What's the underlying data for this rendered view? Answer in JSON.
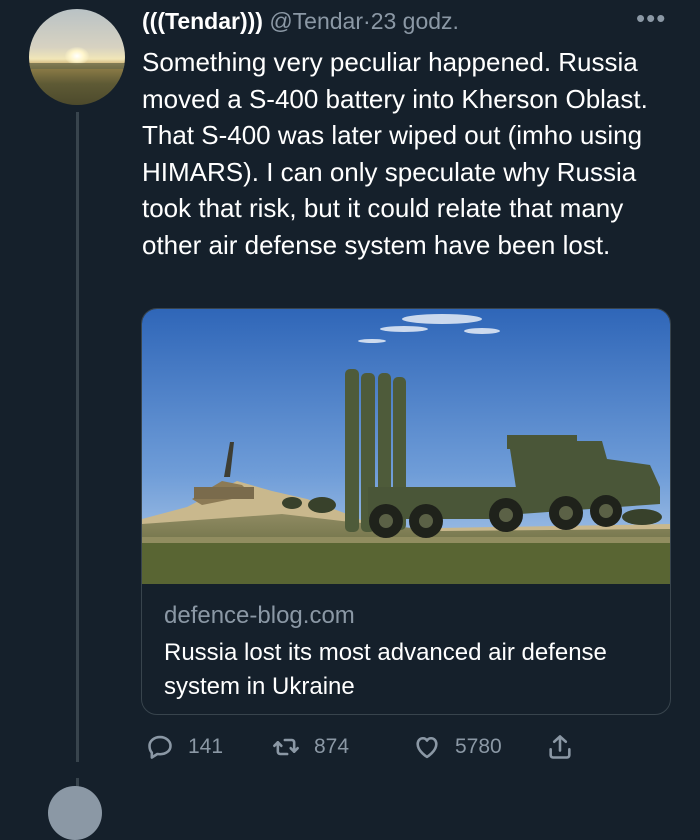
{
  "tweet": {
    "display_name": "(((Tendar)))",
    "handle": "@Tendar",
    "separator": "·",
    "time": "23 godz.",
    "more_label": "•••",
    "text": "Something very peculiar happened. Russia moved a S-400 battery into Kherson Oblast. That S-400 was later wiped out (imho using HIMARS). I can only speculate why Russia took that risk, but it could relate that many other air defense system have been lost."
  },
  "card": {
    "domain": "defence-blog.com",
    "title": "Russia lost its most advanced air defense system in Ukraine"
  },
  "actions": {
    "replies": "141",
    "retweets": "874",
    "likes": "5780"
  },
  "icons": {
    "reply": "reply-icon",
    "retweet": "retweet-icon",
    "like": "heart-icon",
    "share": "share-icon",
    "more": "more-icon"
  },
  "colors": {
    "background": "#15202b",
    "secondary_text": "#8b98a5",
    "border": "#38444d"
  }
}
